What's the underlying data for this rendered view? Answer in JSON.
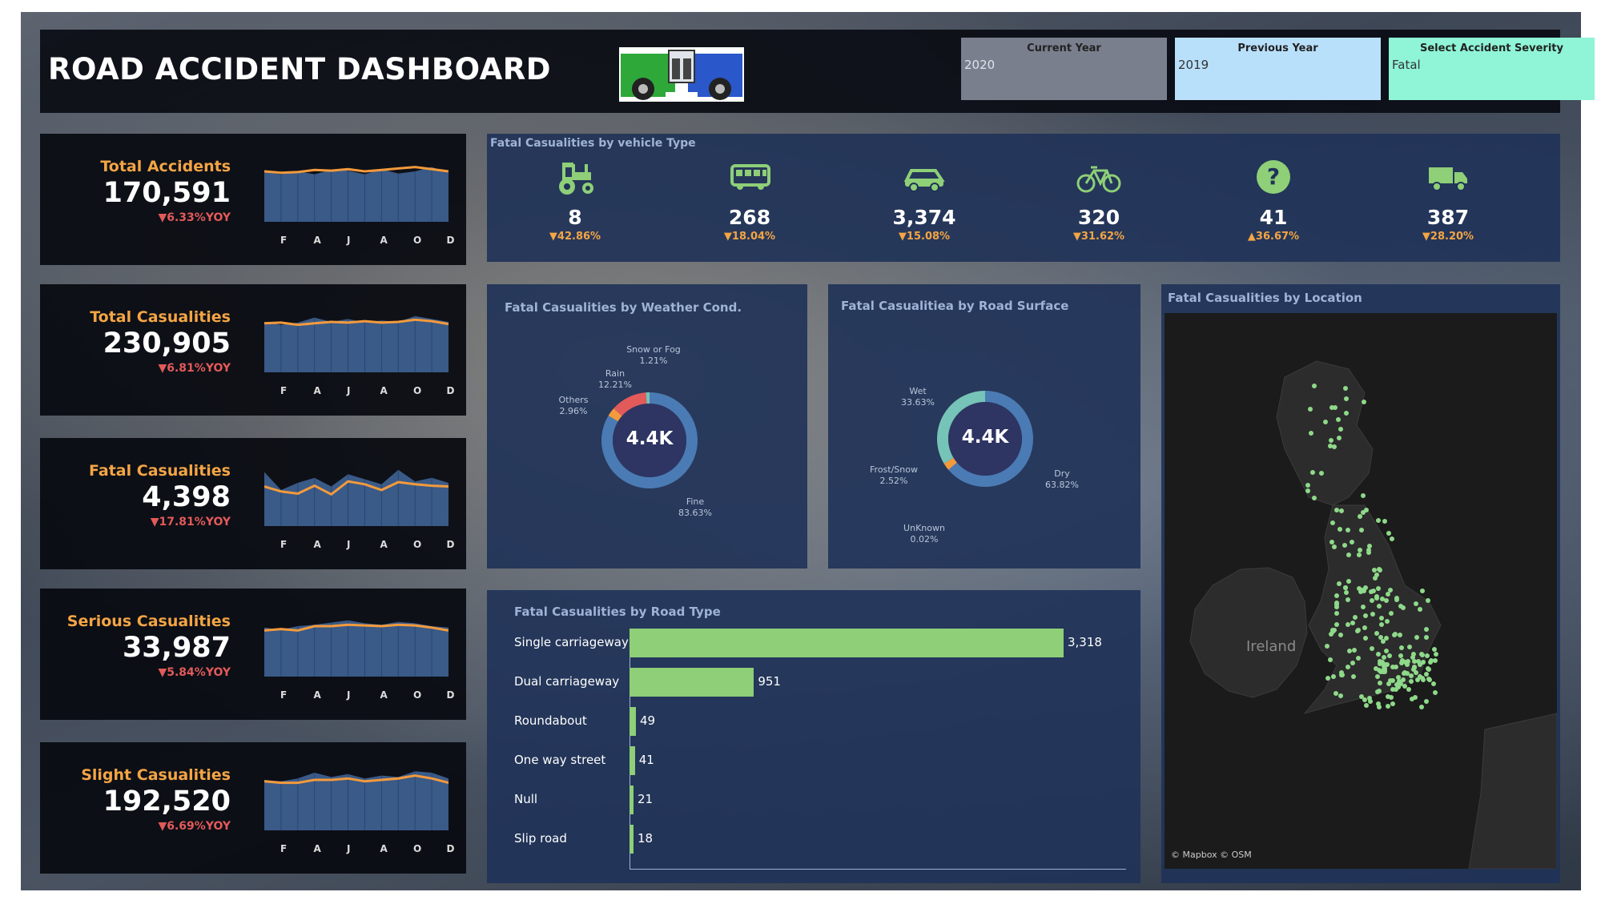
{
  "header": {
    "title": "ROAD ACCIDENT DASHBOARD",
    "filters": [
      {
        "label": "Current Year",
        "value": "2020",
        "color": "#7a7f8e"
      },
      {
        "label": "Previous Year",
        "value": "2019",
        "color": "#b9e0fb"
      },
      {
        "label": "Select Accident Severity",
        "value": "Fatal",
        "color": "#8ff5d6"
      }
    ]
  },
  "months": [
    "F",
    "A",
    "J",
    "A",
    "O",
    "D"
  ],
  "kpis": [
    {
      "label": "Total Accidents",
      "value": "170,591",
      "yoy": "▼6.33%YOY",
      "current": [
        0.69,
        0.66,
        0.7,
        0.66,
        0.72,
        0.71,
        0.66,
        0.73,
        0.67,
        0.7,
        0.76,
        0.68
      ],
      "previous": [
        0.7,
        0.68,
        0.69,
        0.72,
        0.71,
        0.73,
        0.7,
        0.72,
        0.74,
        0.76,
        0.73,
        0.7
      ]
    },
    {
      "label": "Total Casualities",
      "value": "230,905",
      "yoy": "▼6.81%YOY",
      "current": [
        0.7,
        0.66,
        0.69,
        0.76,
        0.7,
        0.74,
        0.69,
        0.72,
        0.7,
        0.78,
        0.74,
        0.7
      ],
      "previous": [
        0.68,
        0.69,
        0.66,
        0.68,
        0.7,
        0.69,
        0.71,
        0.69,
        0.7,
        0.73,
        0.71,
        0.67
      ]
    },
    {
      "label": "Fatal Casualities",
      "value": "4,398",
      "yoy": "▼17.81%YOY",
      "current": [
        0.75,
        0.5,
        0.6,
        0.67,
        0.55,
        0.72,
        0.65,
        0.58,
        0.78,
        0.62,
        0.67,
        0.6
      ],
      "previous": [
        0.55,
        0.48,
        0.45,
        0.56,
        0.44,
        0.62,
        0.58,
        0.5,
        0.61,
        0.58,
        0.56,
        0.55
      ]
    },
    {
      "label": "Serious Casualities",
      "value": "33,987",
      "yoy": "▼5.84%YOY",
      "current": [
        0.68,
        0.65,
        0.7,
        0.72,
        0.75,
        0.78,
        0.74,
        0.72,
        0.76,
        0.74,
        0.7,
        0.68
      ],
      "previous": [
        0.64,
        0.66,
        0.64,
        0.7,
        0.7,
        0.72,
        0.71,
        0.7,
        0.72,
        0.71,
        0.68,
        0.64
      ]
    },
    {
      "label": "Slight Casualities",
      "value": "192,520",
      "yoy": "▼6.69%YOY",
      "current": [
        0.7,
        0.68,
        0.72,
        0.8,
        0.74,
        0.78,
        0.72,
        0.76,
        0.74,
        0.82,
        0.8,
        0.72
      ],
      "previous": [
        0.68,
        0.66,
        0.66,
        0.7,
        0.7,
        0.72,
        0.68,
        0.7,
        0.72,
        0.76,
        0.72,
        0.66
      ]
    }
  ],
  "vehicle": {
    "title": "Fatal Casualities by vehicle Type",
    "items": [
      {
        "icon": "tractor-icon",
        "value": "8",
        "change": "▼42.86%"
      },
      {
        "icon": "bus-icon",
        "value": "268",
        "change": "▼18.04%"
      },
      {
        "icon": "car-icon",
        "value": "3,374",
        "change": "▼15.08%"
      },
      {
        "icon": "bicycle-icon",
        "value": "320",
        "change": "▼31.62%"
      },
      {
        "icon": "question-icon",
        "value": "41",
        "change": "▲36.67%"
      },
      {
        "icon": "truck-icon",
        "value": "387",
        "change": "▼28.20%"
      }
    ]
  },
  "weather": {
    "title": "Fatal Casualities by Weather Cond.",
    "center": "4.4K",
    "slices": [
      {
        "name": "Fine",
        "pct": "83.63%",
        "value": 83.63,
        "color": "#4b7bb4"
      },
      {
        "name": "Others",
        "pct": "2.96%",
        "value": 2.96,
        "color": "#f39a3c"
      },
      {
        "name": "Rain",
        "pct": "12.21%",
        "value": 12.21,
        "color": "#e35a5a"
      },
      {
        "name": "Snow or Fog",
        "pct": "1.21%",
        "value": 1.21,
        "color": "#76c3b7"
      }
    ]
  },
  "surface": {
    "title": "Fatal Casualitiea by Road Surface",
    "center": "4.4K",
    "slices": [
      {
        "name": "Dry",
        "pct": "63.82%",
        "value": 63.82,
        "color": "#4b7bb4"
      },
      {
        "name": "UnKnown",
        "pct": "0.02%",
        "value": 0.02,
        "color": "#9aa5b8"
      },
      {
        "name": "Frost/Snow",
        "pct": "2.52%",
        "value": 2.52,
        "color": "#f39a3c"
      },
      {
        "name": "Wet",
        "pct": "33.63%",
        "value": 33.63,
        "color": "#76c3b7"
      }
    ]
  },
  "roadtype": {
    "title": "Fatal Casualities by Road Type",
    "items": [
      {
        "label": "Single carriageway",
        "value": 3318,
        "display": "3,318"
      },
      {
        "label": "Dual carriageway",
        "value": 951,
        "display": "951"
      },
      {
        "label": "Roundabout",
        "value": 49,
        "display": "49"
      },
      {
        "label": "One way street",
        "value": 41,
        "display": "41"
      },
      {
        "label": "Null",
        "value": 21,
        "display": "21"
      },
      {
        "label": "Slip road",
        "value": 18,
        "display": "18"
      }
    ]
  },
  "map": {
    "title": "Fatal Casualities by Location",
    "label": "Ireland",
    "credit": "© Mapbox © OSM"
  }
}
